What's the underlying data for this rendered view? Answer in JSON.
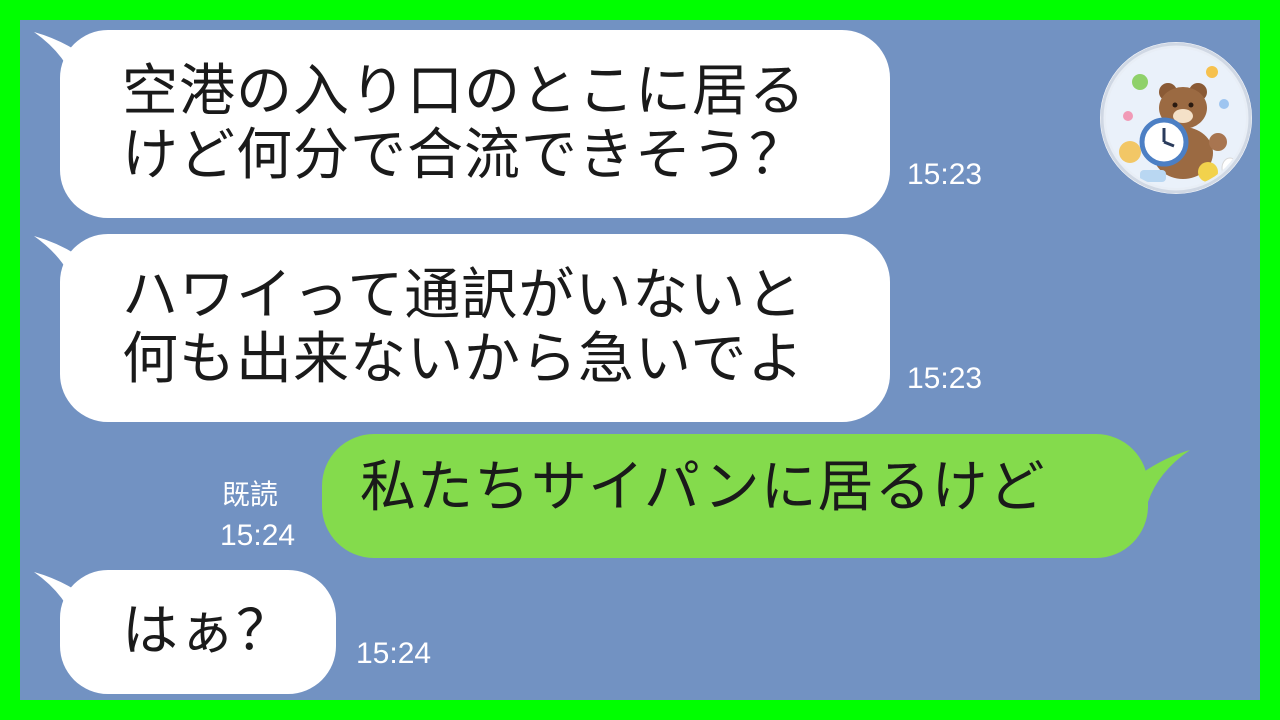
{
  "messages": [
    {
      "sender": "other",
      "lines": [
        "空港の入り口のとこに居る",
        "けど何分で合流できそう？"
      ],
      "time": "15:23"
    },
    {
      "sender": "other",
      "lines": [
        "ハワイって通訳がいないと",
        "何も出来ないから急いでよ"
      ],
      "time": "15:23"
    },
    {
      "sender": "me",
      "lines": [
        "私たちサイパンに居るけど"
      ],
      "time": "15:24",
      "read_label": "既読"
    },
    {
      "sender": "other",
      "lines": [
        "はぁ？"
      ],
      "time": "15:24"
    }
  ],
  "colors": {
    "frame": "#00ff00",
    "chat_background": "#7292c2",
    "incoming_bubble": "#ffffff",
    "outgoing_bubble": "#84db4c",
    "time_text": "#ffffff"
  },
  "avatar": {
    "icon": "bear-clock-avatar-icon"
  }
}
